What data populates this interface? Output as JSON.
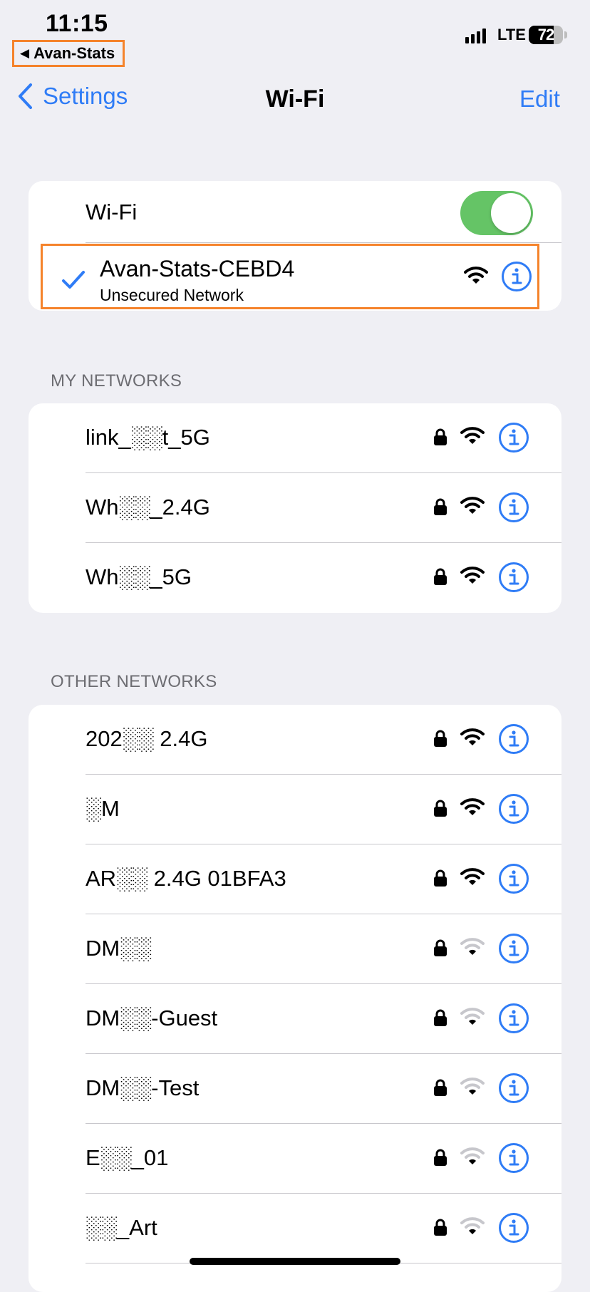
{
  "status_bar": {
    "time": "11:15",
    "back_app_label": "Avan-Stats",
    "network_type": "LTE",
    "battery_percent": "72",
    "battery_level": 0.72
  },
  "nav": {
    "back_label": "Settings",
    "title": "Wi-Fi",
    "edit_label": "Edit"
  },
  "wifi_toggle": {
    "label": "Wi-Fi",
    "on": true
  },
  "current_network": {
    "name": "Avan-Stats-CEBD4",
    "subtitle": "Unsecured Network",
    "connected": true,
    "signal_bars": 3
  },
  "my_networks": {
    "header": "MY NETWORKS",
    "items": [
      {
        "name": "link_░░t_5G",
        "locked": true,
        "signal_bars": 3
      },
      {
        "name": "Wh░░_2.4G",
        "locked": true,
        "signal_bars": 3
      },
      {
        "name": "Wh░░_5G",
        "locked": true,
        "signal_bars": 3
      }
    ]
  },
  "other_networks": {
    "header": "OTHER NETWORKS",
    "items": [
      {
        "name": "202░░ 2.4G",
        "locked": true,
        "signal_bars": 3
      },
      {
        "name": "░M",
        "locked": true,
        "signal_bars": 3
      },
      {
        "name": "AR░░ 2.4G 01BFA3",
        "locked": true,
        "signal_bars": 3
      },
      {
        "name": "DM░░",
        "locked": true,
        "signal_bars": 1
      },
      {
        "name": "DM░░-Guest",
        "locked": true,
        "signal_bars": 1
      },
      {
        "name": "DM░░-Test",
        "locked": true,
        "signal_bars": 1
      },
      {
        "name": "E░░_01",
        "locked": true,
        "signal_bars": 1
      },
      {
        "name": "░░_Art",
        "locked": true,
        "signal_bars": 1
      }
    ]
  },
  "colors": {
    "accent": "#2f7cf6",
    "toggle_on": "#65c466",
    "highlight": "#f5832b",
    "background": "#efeff4",
    "wifi_dim": "#c7c7cc"
  },
  "icons": {
    "back": "chevron-left-icon",
    "check": "checkmark-icon",
    "lock": "lock-icon",
    "wifi": "wifi-icon",
    "info": "info-icon"
  }
}
